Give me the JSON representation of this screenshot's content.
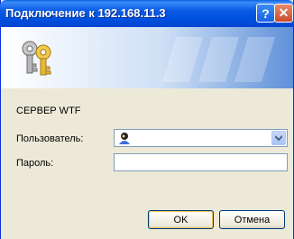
{
  "window": {
    "title": "Подключение к 192.168.11.3",
    "help_label": "?",
    "close_label": "✕"
  },
  "dialog": {
    "server": "СЕРВЕР WTF",
    "user_label": "Пользователь:",
    "user_value": "",
    "password_label": "Пароль:",
    "password_value": "",
    "ok_label": "OK",
    "cancel_label": "Отмена"
  },
  "colors": {
    "titlebar": "#0a5ae6",
    "close": "#c94a2a",
    "dialog_bg": "#ece9d8"
  }
}
